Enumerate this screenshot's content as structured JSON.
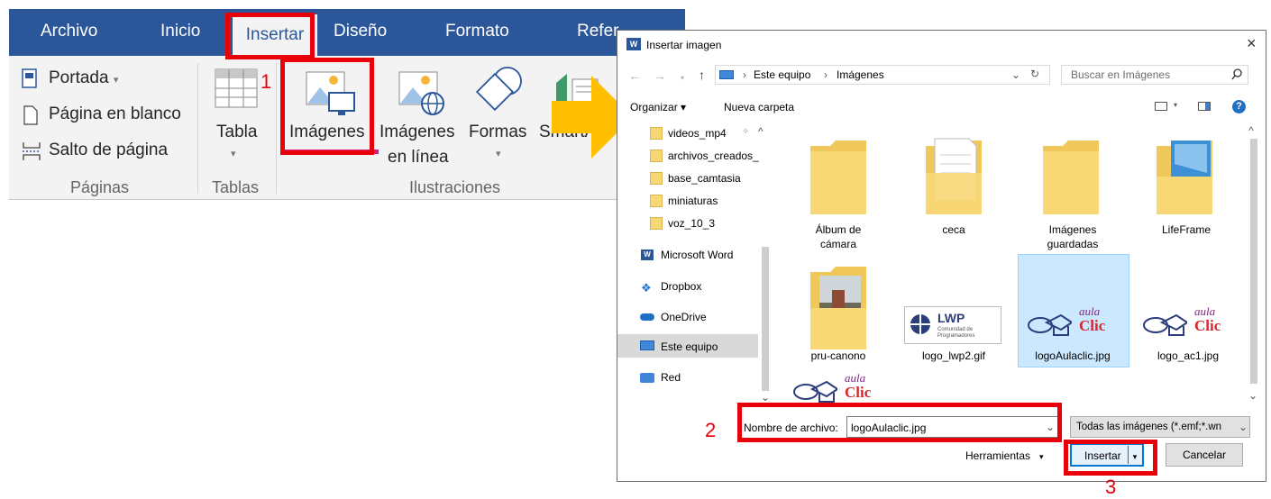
{
  "ribbon": {
    "tabs": [
      "Archivo",
      "Inicio",
      "Insertar",
      "Diseño",
      "Formato",
      "Refer"
    ],
    "paginas": {
      "items": [
        "Portada",
        "Página en blanco",
        "Salto de página"
      ],
      "group_label": "Páginas"
    },
    "tablas": {
      "button": "Tabla",
      "group_label": "Tablas"
    },
    "ilustraciones": {
      "imagenes": "Imágenes",
      "imagenes_en_linea_1": "Imágenes",
      "imagenes_en_linea_2": "en línea",
      "formas": "Formas",
      "smartart": "SmartAr",
      "group_label": "Ilustraciones"
    }
  },
  "callouts": {
    "step1": "1",
    "step2": "2",
    "step3": "3"
  },
  "colors": {
    "word_blue": "#2b579a",
    "callout_red": "#e8000b",
    "arrow": "#ffbf00",
    "selection": "#cce8ff"
  },
  "dialog": {
    "title": "Insertar imagen",
    "close": "×",
    "breadcrumb": [
      "Este equipo",
      "Imágenes"
    ],
    "search_placeholder": "Buscar en Imágenes",
    "toolbar": {
      "organize": "Organizar",
      "new_folder": "Nueva carpeta"
    },
    "nav": {
      "folders": [
        "videos_mp4",
        "archivos_creados_",
        "base_camtasia",
        "miniaturas",
        "voz_10_3"
      ],
      "locations": [
        "Microsoft Word",
        "Dropbox",
        "OneDrive",
        "Este equipo",
        "Red"
      ]
    },
    "items": [
      {
        "name": "Álbum de cámara",
        "l1": "Álbum de",
        "l2": "cámara",
        "kind": "folder"
      },
      {
        "name": "ceca",
        "l1": "ceca",
        "l2": "",
        "kind": "folder"
      },
      {
        "name": "Imágenes guardadas",
        "l1": "Imágenes",
        "l2": "guardadas",
        "kind": "folder"
      },
      {
        "name": "LifeFrame",
        "l1": "LifeFrame",
        "l2": "",
        "kind": "folder"
      },
      {
        "name": "pru-canono",
        "l1": "pru-canono",
        "l2": "",
        "kind": "folder"
      },
      {
        "name": "logo_lwp2.gif",
        "l1": "logo_lwp2.gif",
        "l2": "",
        "kind": "image"
      },
      {
        "name": "logoAulaclic.jpg",
        "l1": "logoAulaclic.jpg",
        "l2": "",
        "kind": "image",
        "selected": true
      },
      {
        "name": "logo_ac1.jpg",
        "l1": "logo_ac1.jpg",
        "l2": "",
        "kind": "image"
      }
    ],
    "lwp_logo_text": {
      "big": "LWP",
      "small1": "Comunidad de",
      "small2": "Programadores"
    },
    "aula_logo_text": {
      "aula": "aula",
      "clic": "Clic"
    },
    "filename_label": "Nombre de archivo:",
    "filename_value": "logoAulaclic.jpg",
    "filter_value": "Todas las imágenes (*.emf;*.wn",
    "tools_label": "Herramientas",
    "insert_label": "Insertar",
    "cancel_label": "Cancelar"
  }
}
